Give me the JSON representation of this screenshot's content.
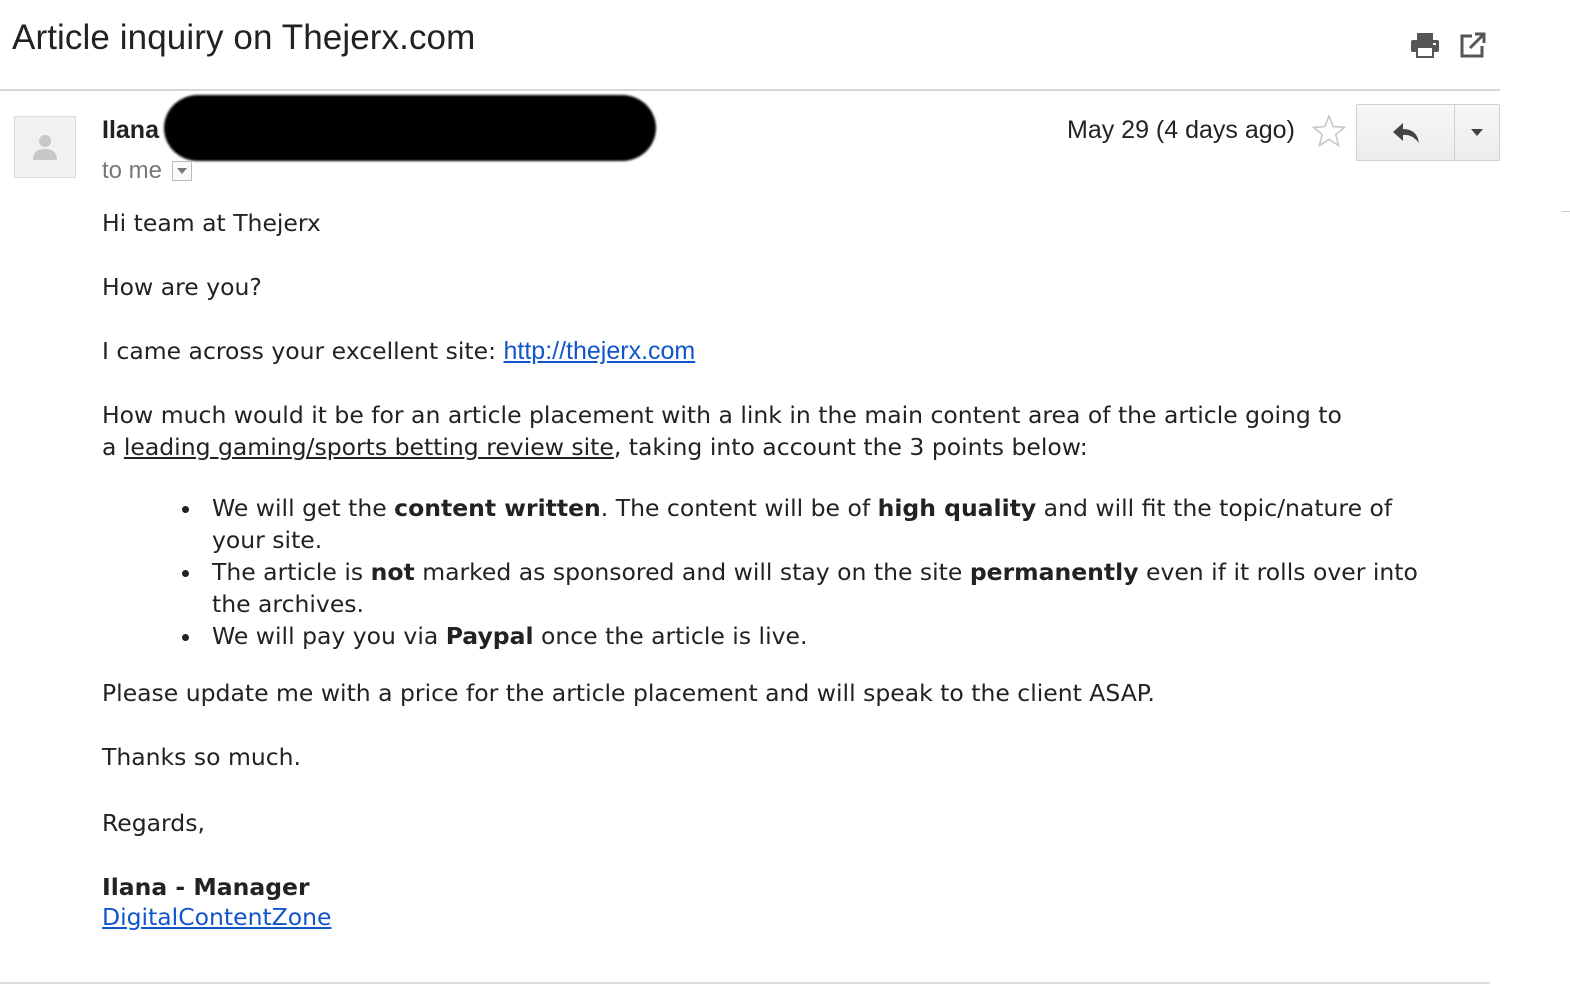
{
  "subject": "Article inquiry on Thejerx.com",
  "toolbar": {
    "print_icon": "print-icon",
    "popout_icon": "new-window-icon"
  },
  "message": {
    "sender_name": "Ilana",
    "recipient": "to me",
    "date": "May 29 (4 days ago)",
    "star_icon": "star-icon",
    "reply_icon": "reply-icon",
    "more_icon": "dropdown-arrow-icon"
  },
  "body": {
    "greeting": "Hi team at Thejerx",
    "how_are_you": "How are you?",
    "intro_text": "I came across your excellent site: ",
    "site_link": "http://thejerx.com",
    "ask_line1": "How much would it be for an article placement with a link in the main content area of the article going to",
    "ask_line2_prefix": "a ",
    "ask_line2_underlined": "leading gaming/sports betting review site",
    "ask_line2_suffix": ", taking into account the 3 points below:",
    "bullets": [
      {
        "l1_a": "We will get the ",
        "l1_b": "content written",
        "l1_c": ". The content will be of ",
        "l1_d": "high quality",
        "l1_e": " and will fit the topic/nature of",
        "l2": "your site."
      },
      {
        "l1_a": "The article is ",
        "l1_b": "not",
        "l1_c": " marked as sponsored and will stay on the site ",
        "l1_d": "permanently",
        "l1_e": " even if it rolls over into",
        "l2": "the archives."
      },
      {
        "l1_a": "We will pay you via ",
        "l1_b": "Paypal",
        "l1_c": " once the article is live."
      }
    ],
    "update_request": "Please update me with a price for the article placement and will speak to the client ASAP.",
    "thanks": "Thanks so much.",
    "regards": "Regards,",
    "signature_name": "Ilana - Manager",
    "signature_link": "DigitalContentZone"
  }
}
